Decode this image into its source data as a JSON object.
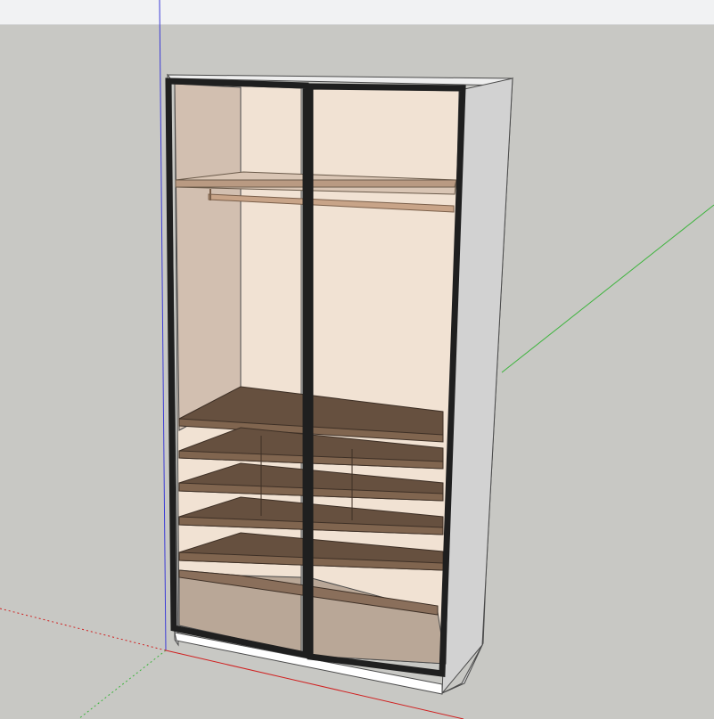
{
  "scene": {
    "subject": "wardrobe",
    "view": "3d-perspective",
    "axis_colors": {
      "blue": "#3b3bd6",
      "green": "#3cb43c",
      "red": "#d02020"
    },
    "materials": {
      "carcass": "#d2d2d2",
      "carcass_top": "#eeeeee",
      "door_frame": "#1f1f1f",
      "interior_light": "#f1e2d3",
      "interior_side": "#d2bfb0",
      "shelf": "#66503f",
      "shelf_edge": "#80654f",
      "rail": "#c8a488",
      "plinth": "#ffffff",
      "background": "#c8c8c4"
    }
  }
}
